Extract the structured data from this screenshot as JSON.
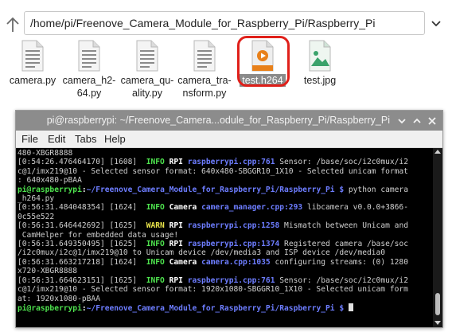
{
  "file_manager": {
    "path": "/home/pi/Freenove_Camera_Module_for_Raspberry_Pi/Raspberry_Pi",
    "files": [
      {
        "name": "camera.py",
        "type": "python",
        "selected": false
      },
      {
        "name": "camera_h2-\n64.py",
        "type": "python",
        "selected": false
      },
      {
        "name": "camera_qu-\nality.py",
        "type": "python",
        "selected": false
      },
      {
        "name": "camera_tra-\nnsform.py",
        "type": "python",
        "selected": false
      },
      {
        "name": "test.h264",
        "type": "video",
        "selected": true
      },
      {
        "name": "test.jpg",
        "type": "image",
        "selected": false
      }
    ]
  },
  "terminal": {
    "title": "pi@raspberrypi: ~/Freenove_Camera...odule_for_Raspberry_Pi/Raspberry_Pi",
    "menu": [
      "File",
      "Edit",
      "Tabs",
      "Help"
    ],
    "lines": [
      [
        [
          "480-XBGR8888",
          ""
        ]
      ],
      [
        [
          "[0:54:26.476464170] [1608]  ",
          ""
        ],
        [
          "INFO",
          "g"
        ],
        [
          " ",
          ""
        ],
        [
          "RPI",
          "w"
        ],
        [
          " ",
          ""
        ],
        [
          "raspberrypi.cpp:761",
          "b"
        ],
        [
          " Sensor: /base/soc/i2c0mux/i2",
          ""
        ]
      ],
      [
        [
          "c@1/imx219@10 - Selected sensor format: 640x480-SBGGR10_1X10 - Selected unicam format",
          ""
        ]
      ],
      [
        [
          ": 640x480-pBAA",
          ""
        ]
      ],
      [
        [
          "pi@raspberrypi",
          "g"
        ],
        [
          ":",
          "w"
        ],
        [
          "~/Freenove_Camera_Module_for_Raspberry_Pi/Raspberry_Pi $",
          "b"
        ],
        [
          " python camera",
          ""
        ]
      ],
      [
        [
          "_h264.py",
          ""
        ]
      ],
      [
        [
          "[0:56:31.484048354] [1624]  ",
          ""
        ],
        [
          "INFO",
          "g"
        ],
        [
          " ",
          ""
        ],
        [
          "Camera",
          "w"
        ],
        [
          " ",
          ""
        ],
        [
          "camera_manager.cpp:293",
          "b"
        ],
        [
          " libcamera v0.0.0+3866-",
          ""
        ]
      ],
      [
        [
          "0c55e522",
          ""
        ]
      ],
      [
        [
          "[0:56:31.646442692] [1625]  ",
          ""
        ],
        [
          "WARN",
          "y"
        ],
        [
          " ",
          ""
        ],
        [
          "RPI",
          "w"
        ],
        [
          " ",
          ""
        ],
        [
          "raspberrypi.cpp:1258",
          "b"
        ],
        [
          " Mismatch between Unicam and",
          ""
        ]
      ],
      [
        [
          " CamHelper for embedded data usage!",
          ""
        ]
      ],
      [
        [
          "[0:56:31.649350495] [1625]  ",
          ""
        ],
        [
          "INFO",
          "g"
        ],
        [
          " ",
          ""
        ],
        [
          "RPI",
          "w"
        ],
        [
          " ",
          ""
        ],
        [
          "raspberrypi.cpp:1374",
          "b"
        ],
        [
          " Registered camera /base/soc",
          ""
        ]
      ],
      [
        [
          "/i2c0mux/i2c@1/imx219@10 to Unicam device /dev/media3 and ISP device /dev/media0",
          ""
        ]
      ],
      [
        [
          "[0:56:31.663217218] [1624]  ",
          ""
        ],
        [
          "INFO",
          "g"
        ],
        [
          " ",
          ""
        ],
        [
          "Camera",
          "w"
        ],
        [
          " ",
          ""
        ],
        [
          "camera.cpp:1035",
          "b"
        ],
        [
          " configuring streams: (0) 1280",
          ""
        ]
      ],
      [
        [
          "x720-XBGR8888",
          ""
        ]
      ],
      [
        [
          "[0:56:31.664623151] [1625]  ",
          ""
        ],
        [
          "INFO",
          "g"
        ],
        [
          " ",
          ""
        ],
        [
          "RPI",
          "w"
        ],
        [
          " ",
          ""
        ],
        [
          "raspberrypi.cpp:761",
          "b"
        ],
        [
          " Sensor: /base/soc/i2c0mux/i2",
          ""
        ]
      ],
      [
        [
          "c@1/imx219@10 - Selected sensor format: 1920x1080-SBGGR10_1X10 - Selected unicam form",
          ""
        ]
      ],
      [
        [
          "at: 1920x1080-pBAA",
          ""
        ]
      ],
      [
        [
          "pi@raspberrypi",
          "g"
        ],
        [
          ":",
          "w"
        ],
        [
          "~/Freenove_Camera_Module_for_Raspberry_Pi/Raspberry_Pi $",
          "b"
        ],
        [
          " ",
          ""
        ],
        [
          "__CURSOR__",
          ""
        ]
      ]
    ]
  },
  "colors": {
    "highlight_ring": "#e0201a",
    "video_icon": "#e8801a",
    "image_icon": "#3aa36b",
    "prompt_user": "#4ee34e",
    "prompt_path": "#6d7dff"
  }
}
